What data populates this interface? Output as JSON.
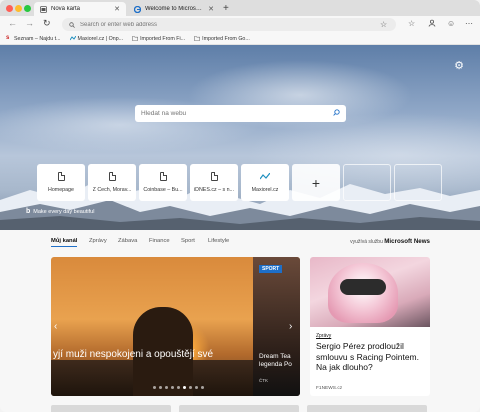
{
  "window": {
    "tabs": [
      {
        "label": "Nová karta",
        "active": true
      },
      {
        "label": "Welcome to Microsoft Edge C",
        "active": false
      }
    ],
    "new_tab": "+",
    "traffic_lights": [
      "#fe5f57",
      "#febc2e",
      "#28c840"
    ]
  },
  "toolbar": {
    "address_placeholder": "Search or enter web address"
  },
  "favorites": [
    {
      "label": "Seznam – Najdu t...",
      "icon": "seznam-icon",
      "color": "#cc2222"
    },
    {
      "label": "Maxiorel.cz | Onp...",
      "icon": "maxiorel-icon",
      "color": "#1e8fbf"
    },
    {
      "label": "Imported From Fi...",
      "icon": "folder-icon",
      "color": "#9b9b9b"
    },
    {
      "label": "Imported From Go...",
      "icon": "folder-icon",
      "color": "#9b9b9b"
    }
  ],
  "hero": {
    "search_placeholder": "Hledat na webu",
    "tiles": [
      "Homepage",
      "Z Čech, Morav...",
      "Coinbase – Bu...",
      "iDNES.cz – s n...",
      "Maxiorel.cz"
    ],
    "add_tile": "+",
    "bing_caption": "Make every day beautiful"
  },
  "news": {
    "tabs": [
      "Můj kanál",
      "Zprávy",
      "Zábava",
      "Finance",
      "Sport",
      "Lifestyle"
    ],
    "powered_by_prefix": "využívá službu",
    "powered_by_brand": "Microsoft News",
    "main_headline": "yjí muži nespokojeni a opouštějí své",
    "side_badge": "SPORT",
    "side_headline_1": "Dream Tea",
    "side_headline_2": "legenda Po",
    "side_source": "ČTK",
    "right_category": "Zprávy",
    "right_title": "Sergio Pérez prodloužil smlouvu s Racing Pointem. Na jak dlouho?",
    "right_source": "F1NEWS.cz"
  },
  "colors": {
    "accent": "#1e6fc8"
  }
}
